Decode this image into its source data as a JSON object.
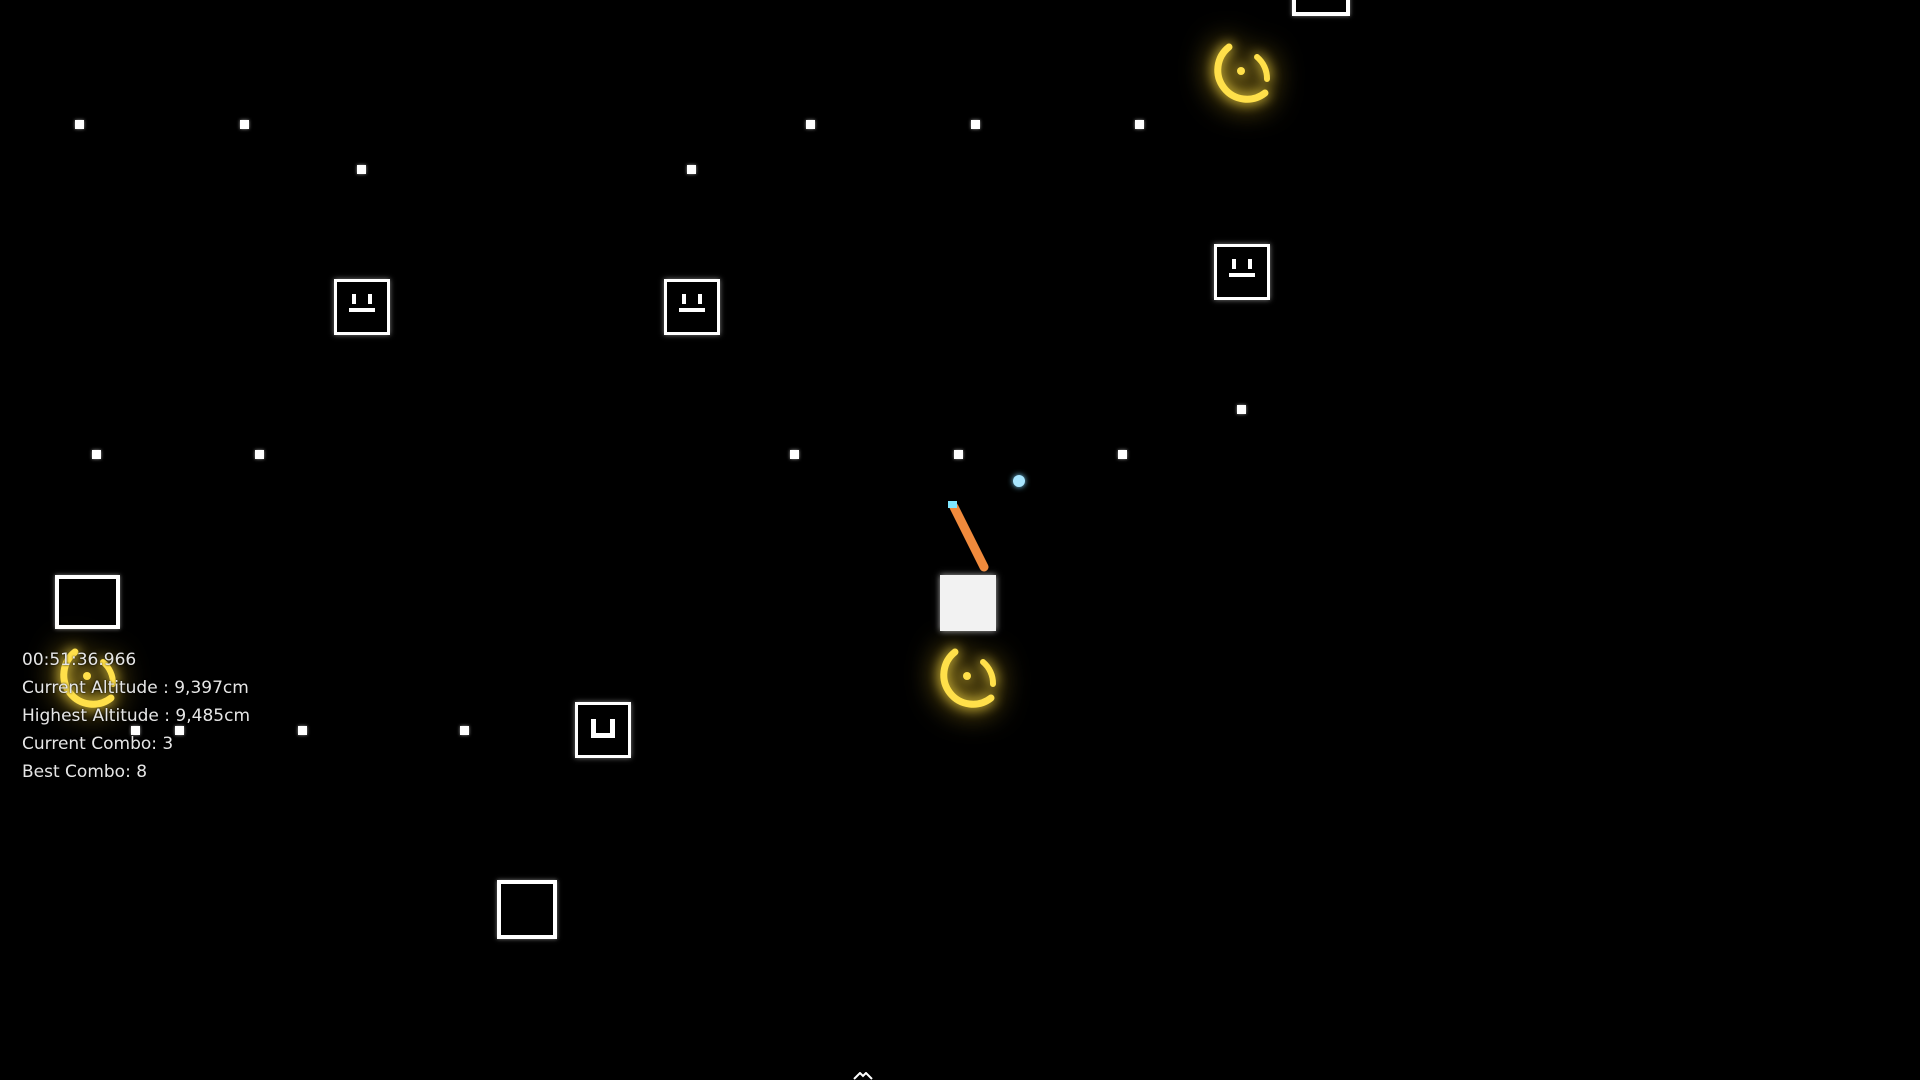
{
  "hud": {
    "timer": "00:51:36.966",
    "current_altitude": "Current Altitude : 9,397cm",
    "highest_altitude": "Highest Altitude : 9,485cm",
    "current_combo": "Current Combo: 3",
    "best_combo": "Best Combo: 8"
  },
  "colors": {
    "background": "#000000",
    "block": "#ffffff",
    "ring": "#ffd21e",
    "rope": "#f08a3c",
    "spark": "#a8e6ff"
  },
  "icons": {
    "ring": "glowing-gold-ring",
    "face": "smiling-face-block",
    "player": "white-cube"
  }
}
